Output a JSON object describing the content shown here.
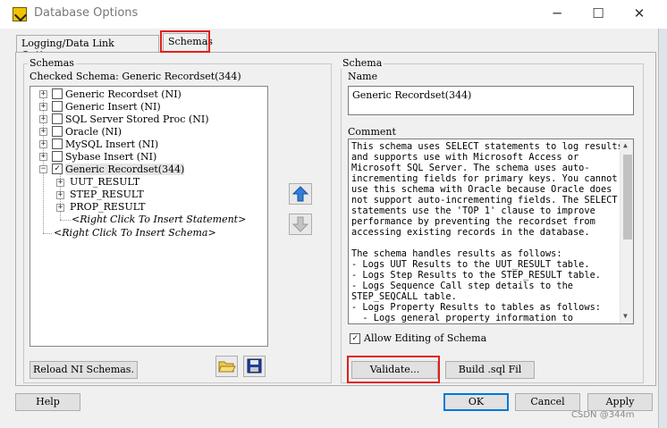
{
  "window": {
    "title": "Database Options",
    "minimize_glyph": "─",
    "maximize_glyph": "☐",
    "close_glyph": "✕",
    "icon": "teststand-app-icon"
  },
  "tabs": [
    {
      "label": "Logging/Data Link Options"
    },
    {
      "label": "Schemas"
    }
  ],
  "schemas_panel": {
    "group_label": "Schemas",
    "checked_schema": "Checked Schema: Generic Recordset(344)",
    "tree": [
      {
        "label": "Generic Recordset (NI)"
      },
      {
        "label": "Generic Insert (NI)"
      },
      {
        "label": "SQL Server Stored Proc (NI)"
      },
      {
        "label": "Oracle (NI)"
      },
      {
        "label": "MySQL Insert (NI)"
      },
      {
        "label": "Sybase Insert (NI)"
      },
      {
        "label": "Generic Recordset(344)",
        "children": [
          "UUT_RESULT",
          "STEP_RESULT",
          "PROP_RESULT"
        ],
        "insert_statement": "<Right Click To Insert Statement>"
      }
    ],
    "insert_schema": "<Right Click To Insert Schema>",
    "reload_button": "Reload NI Schemas."
  },
  "schema_panel": {
    "group_label": "Schema",
    "name_label": "Name",
    "name_value": "Generic Recordset(344)",
    "comment_label": "Comment",
    "comment_lines": [
      "This schema uses SELECT statements to log results",
      "and supports use with Microsoft Access or",
      "Microsoft SQL Server. The schema uses auto-",
      "incrementing fields for primary keys. You cannot",
      "use this schema with Oracle because Oracle does",
      "not support auto-incrementing fields. The SELECT",
      "statements use the 'TOP 1' clause to improve",
      "performance by preventing the recordset from",
      "accessing existing records in the database.",
      "",
      "The schema handles results as follows:",
      "- Logs UUT Results to the UUT_RESULT table.",
      "- Logs Step Results to the STEP_RESULT table.",
      "- Logs Sequence Call step details to the",
      "STEP_SEQCALL table.",
      "- Logs Property Results to tables as follows:",
      "  - Logs general property information to"
    ],
    "allow_editing_label": "Allow Editing of Schema",
    "allow_editing_checked": true,
    "validate_button": "Validate...",
    "build_sql_button": "Build .sql Fil"
  },
  "footer": {
    "help": "Help",
    "ok": "OK",
    "cancel": "Cancel",
    "apply": "Apply"
  },
  "watermark": "CSDN @344m",
  "colors": {
    "highlight_red": "#e0201b",
    "arrow_blue": "#2f7fd8",
    "dialog_bg": "#f0f0f0"
  }
}
